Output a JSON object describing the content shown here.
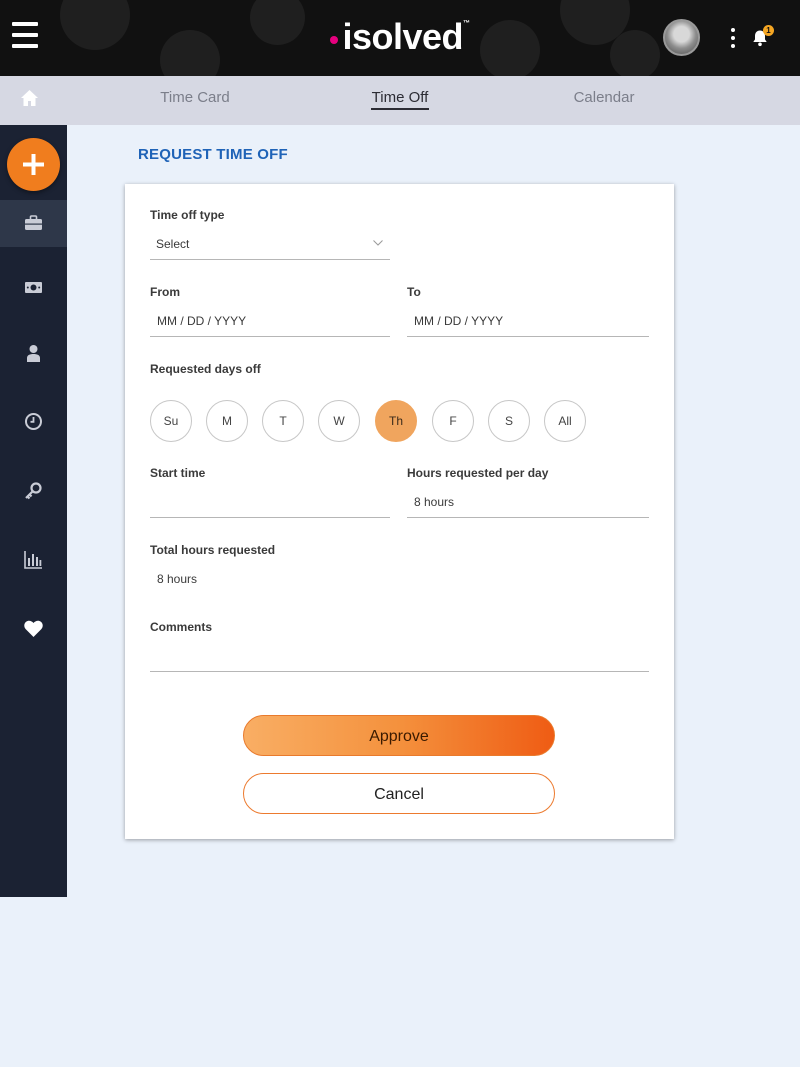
{
  "app": {
    "logo_text": "isolved",
    "logo_tm": "™",
    "notification_count": "1"
  },
  "subnav": {
    "tabs": [
      {
        "label": "Time Card",
        "active": false
      },
      {
        "label": "Time Off",
        "active": true
      },
      {
        "label": "Calendar",
        "active": false
      }
    ]
  },
  "sidebar": {
    "items": [
      {
        "icon": "briefcase-icon",
        "active": true
      },
      {
        "icon": "money-icon",
        "active": false
      },
      {
        "icon": "person-icon",
        "active": false
      },
      {
        "icon": "clock-icon",
        "active": false
      },
      {
        "icon": "key-icon",
        "active": false
      },
      {
        "icon": "bar-chart-icon",
        "active": false
      },
      {
        "icon": "heart-icon",
        "active": false
      }
    ]
  },
  "page": {
    "title": "REQUEST TIME OFF"
  },
  "form": {
    "time_off_type": {
      "label": "Time off type",
      "value": "Select"
    },
    "from": {
      "label": "From",
      "placeholder": "MM / DD / YYYY"
    },
    "to": {
      "label": "To",
      "placeholder": "MM / DD / YYYY"
    },
    "requested_days": {
      "label": "Requested days off",
      "days": [
        {
          "label": "Su",
          "selected": false
        },
        {
          "label": "M",
          "selected": false
        },
        {
          "label": "T",
          "selected": false
        },
        {
          "label": "W",
          "selected": false
        },
        {
          "label": "Th",
          "selected": true
        },
        {
          "label": "F",
          "selected": false
        },
        {
          "label": "S",
          "selected": false
        },
        {
          "label": "All",
          "selected": false
        }
      ]
    },
    "start_time": {
      "label": "Start time",
      "value": ""
    },
    "hours_per_day": {
      "label": "Hours requested per day",
      "value": "8 hours"
    },
    "total_hours": {
      "label": "Total hours requested",
      "value": "8 hours"
    },
    "comments": {
      "label": "Comments",
      "value": ""
    },
    "approve_label": "Approve",
    "cancel_label": "Cancel"
  },
  "colors": {
    "accent_orange": "#f07d1e",
    "title_blue": "#1f63b7",
    "sidebar_bg": "#1b2233",
    "logo_dot": "#e6007e"
  }
}
